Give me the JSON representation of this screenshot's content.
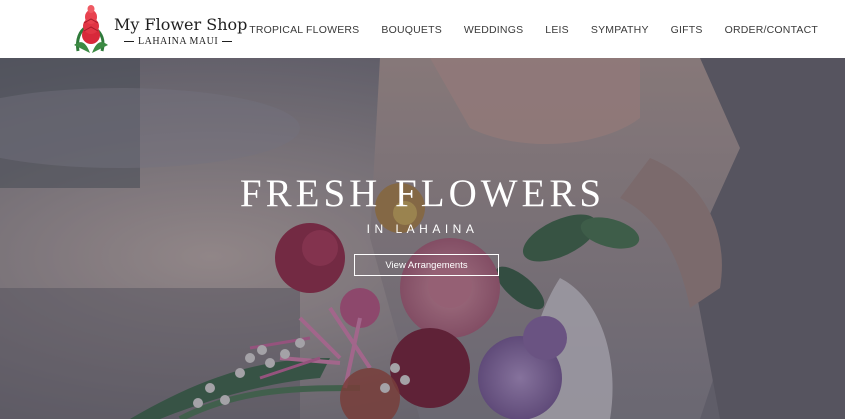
{
  "header": {
    "logo_title": "My Flower Shop",
    "logo_subtitle": "LAHAINA MAUI",
    "logo_icon": "red-ginger-flower-icon",
    "nav": [
      {
        "label": "TROPICAL FLOWERS"
      },
      {
        "label": "BOUQUETS"
      },
      {
        "label": "WEDDINGS"
      },
      {
        "label": "LEIS"
      },
      {
        "label": "SYMPATHY"
      },
      {
        "label": "GIFTS"
      },
      {
        "label": "ORDER/CONTACT"
      }
    ]
  },
  "hero": {
    "title": "FRESH FLOWERS",
    "subtitle": "IN LAHAINA",
    "button_label": "View Arrangements",
    "overlay_color": "#28283c"
  }
}
